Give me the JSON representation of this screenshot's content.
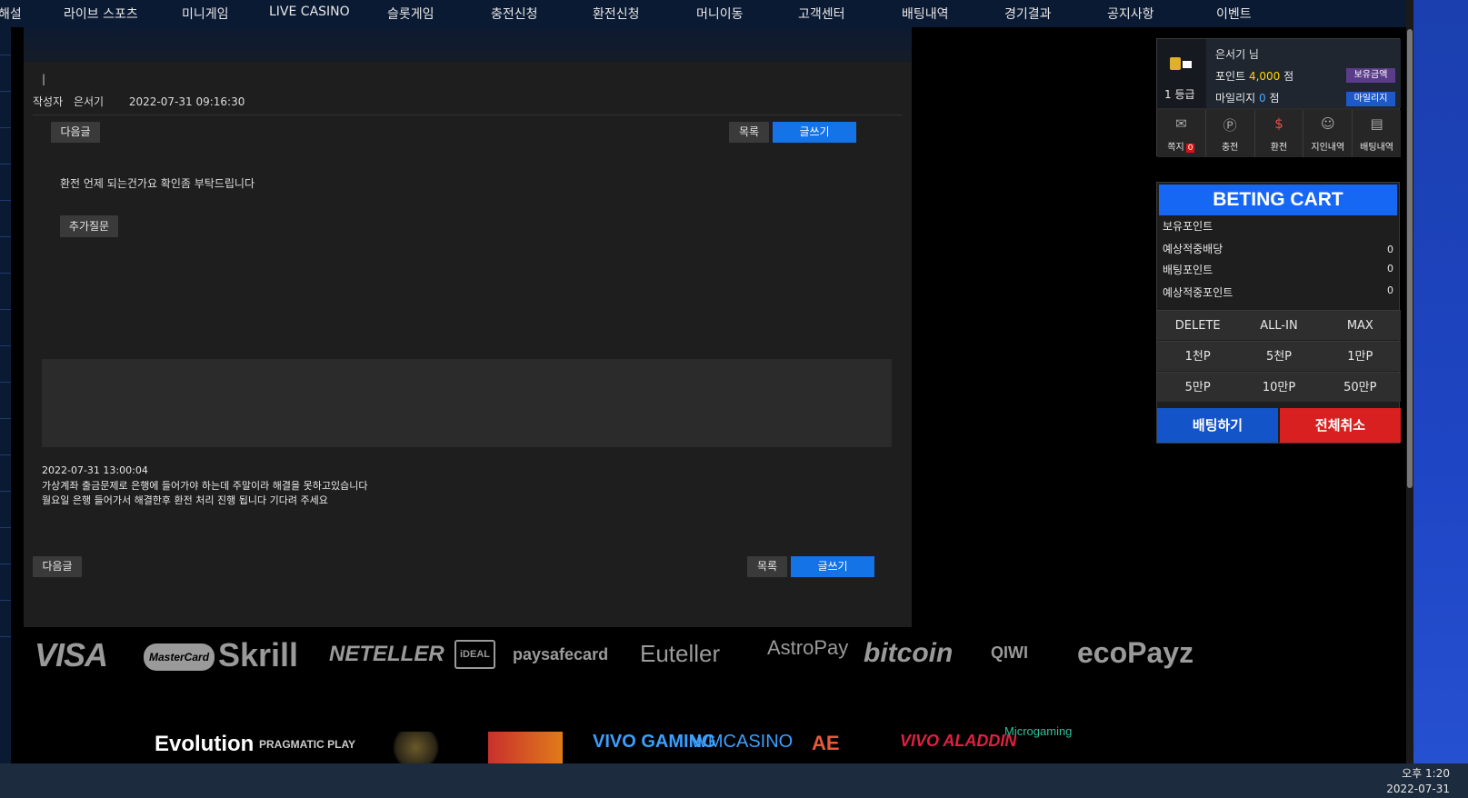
{
  "nav": {
    "items": [
      "해설",
      "라이브 스포츠",
      "미니게임",
      "LIVE CASINO",
      "슬롯게임",
      "충전신청",
      "환전신청",
      "머니이동",
      "고객센터",
      "배팅내역",
      "경기결과",
      "공지사항",
      "이벤트"
    ]
  },
  "post": {
    "cursor": "|",
    "author_label": "작성자",
    "author_name": "은서기",
    "date": "2022-07-31 09:16:30",
    "next_label": "다음글",
    "list_label": "목록",
    "write_label": "글쓰기",
    "question": "환전 언제 되는건가요 확인좀 부탁드립니다",
    "followup_label": "추가질문"
  },
  "answer": {
    "date": "2022-07-31 13:00:04",
    "line1": "가상계좌 출금문제로 은행에 들어가야 하는데 주말이라 해결을 못하고있습니다",
    "line2": "월요일 은행 들어가서 해결한후 환전 처리 진행 됩니다 기다려 주세요"
  },
  "bottom_buttons": {
    "next_label": "다음글",
    "list_label": "목록",
    "write_label": "글쓰기"
  },
  "payment_logos": [
    "VISA",
    "MasterCard",
    "Skrill",
    "NETELLER",
    "iDEAL",
    "paysafecard",
    "Euteller",
    "AstroPay",
    "bitcoin",
    "QIWI",
    "ecoPayz"
  ],
  "game_logos": [
    "Evolution",
    "PRAGMATIC PLAY",
    "VIVO GAMING",
    "WMCASINO",
    "AE",
    "VIVO ALADDIN",
    "Microgaming"
  ],
  "user": {
    "level": "1 등급",
    "name": "은서기 님",
    "point_label": "포인트",
    "point_value": "4,000",
    "point_unit": "점",
    "mileage_label": "마일리지",
    "mileage_value": "0",
    "mileage_unit": "점",
    "balance_tag": "보유금액",
    "mileage_tag": "마일리지",
    "icons": [
      {
        "label": "쪽지",
        "badge": "0",
        "icon": "envelope-icon"
      },
      {
        "label": "충전",
        "icon": "deposit-icon"
      },
      {
        "label": "환전",
        "icon": "exchange-icon"
      },
      {
        "label": "지인내역",
        "icon": "person-icon"
      },
      {
        "label": "배팅내역",
        "icon": "document-icon"
      }
    ]
  },
  "cart": {
    "title": "BETING CART",
    "rows": [
      {
        "label": "보유포인트",
        "value": ""
      },
      {
        "label": "예상적중배당",
        "value": "0"
      },
      {
        "label": "배팅포인트",
        "value": "0"
      },
      {
        "label": "예상적중포인트",
        "value": "0"
      }
    ],
    "actions": [
      "DELETE",
      "ALL-IN",
      "MAX"
    ],
    "amounts_row1": [
      "1천P",
      "5천P",
      "1만P"
    ],
    "amounts_row2": [
      "5만P",
      "10만P",
      "50만P"
    ],
    "bet_label": "배팅하기",
    "cancel_label": "전체취소"
  },
  "taskbar": {
    "time": "오후 1:20",
    "date": "2022-07-31"
  },
  "colors": {
    "nav_bg": "#0b1a33",
    "accent_blue": "#1473e6",
    "cart_title": "#1767f5",
    "cancel_red": "#d92020",
    "point_yellow": "#ffd600"
  }
}
